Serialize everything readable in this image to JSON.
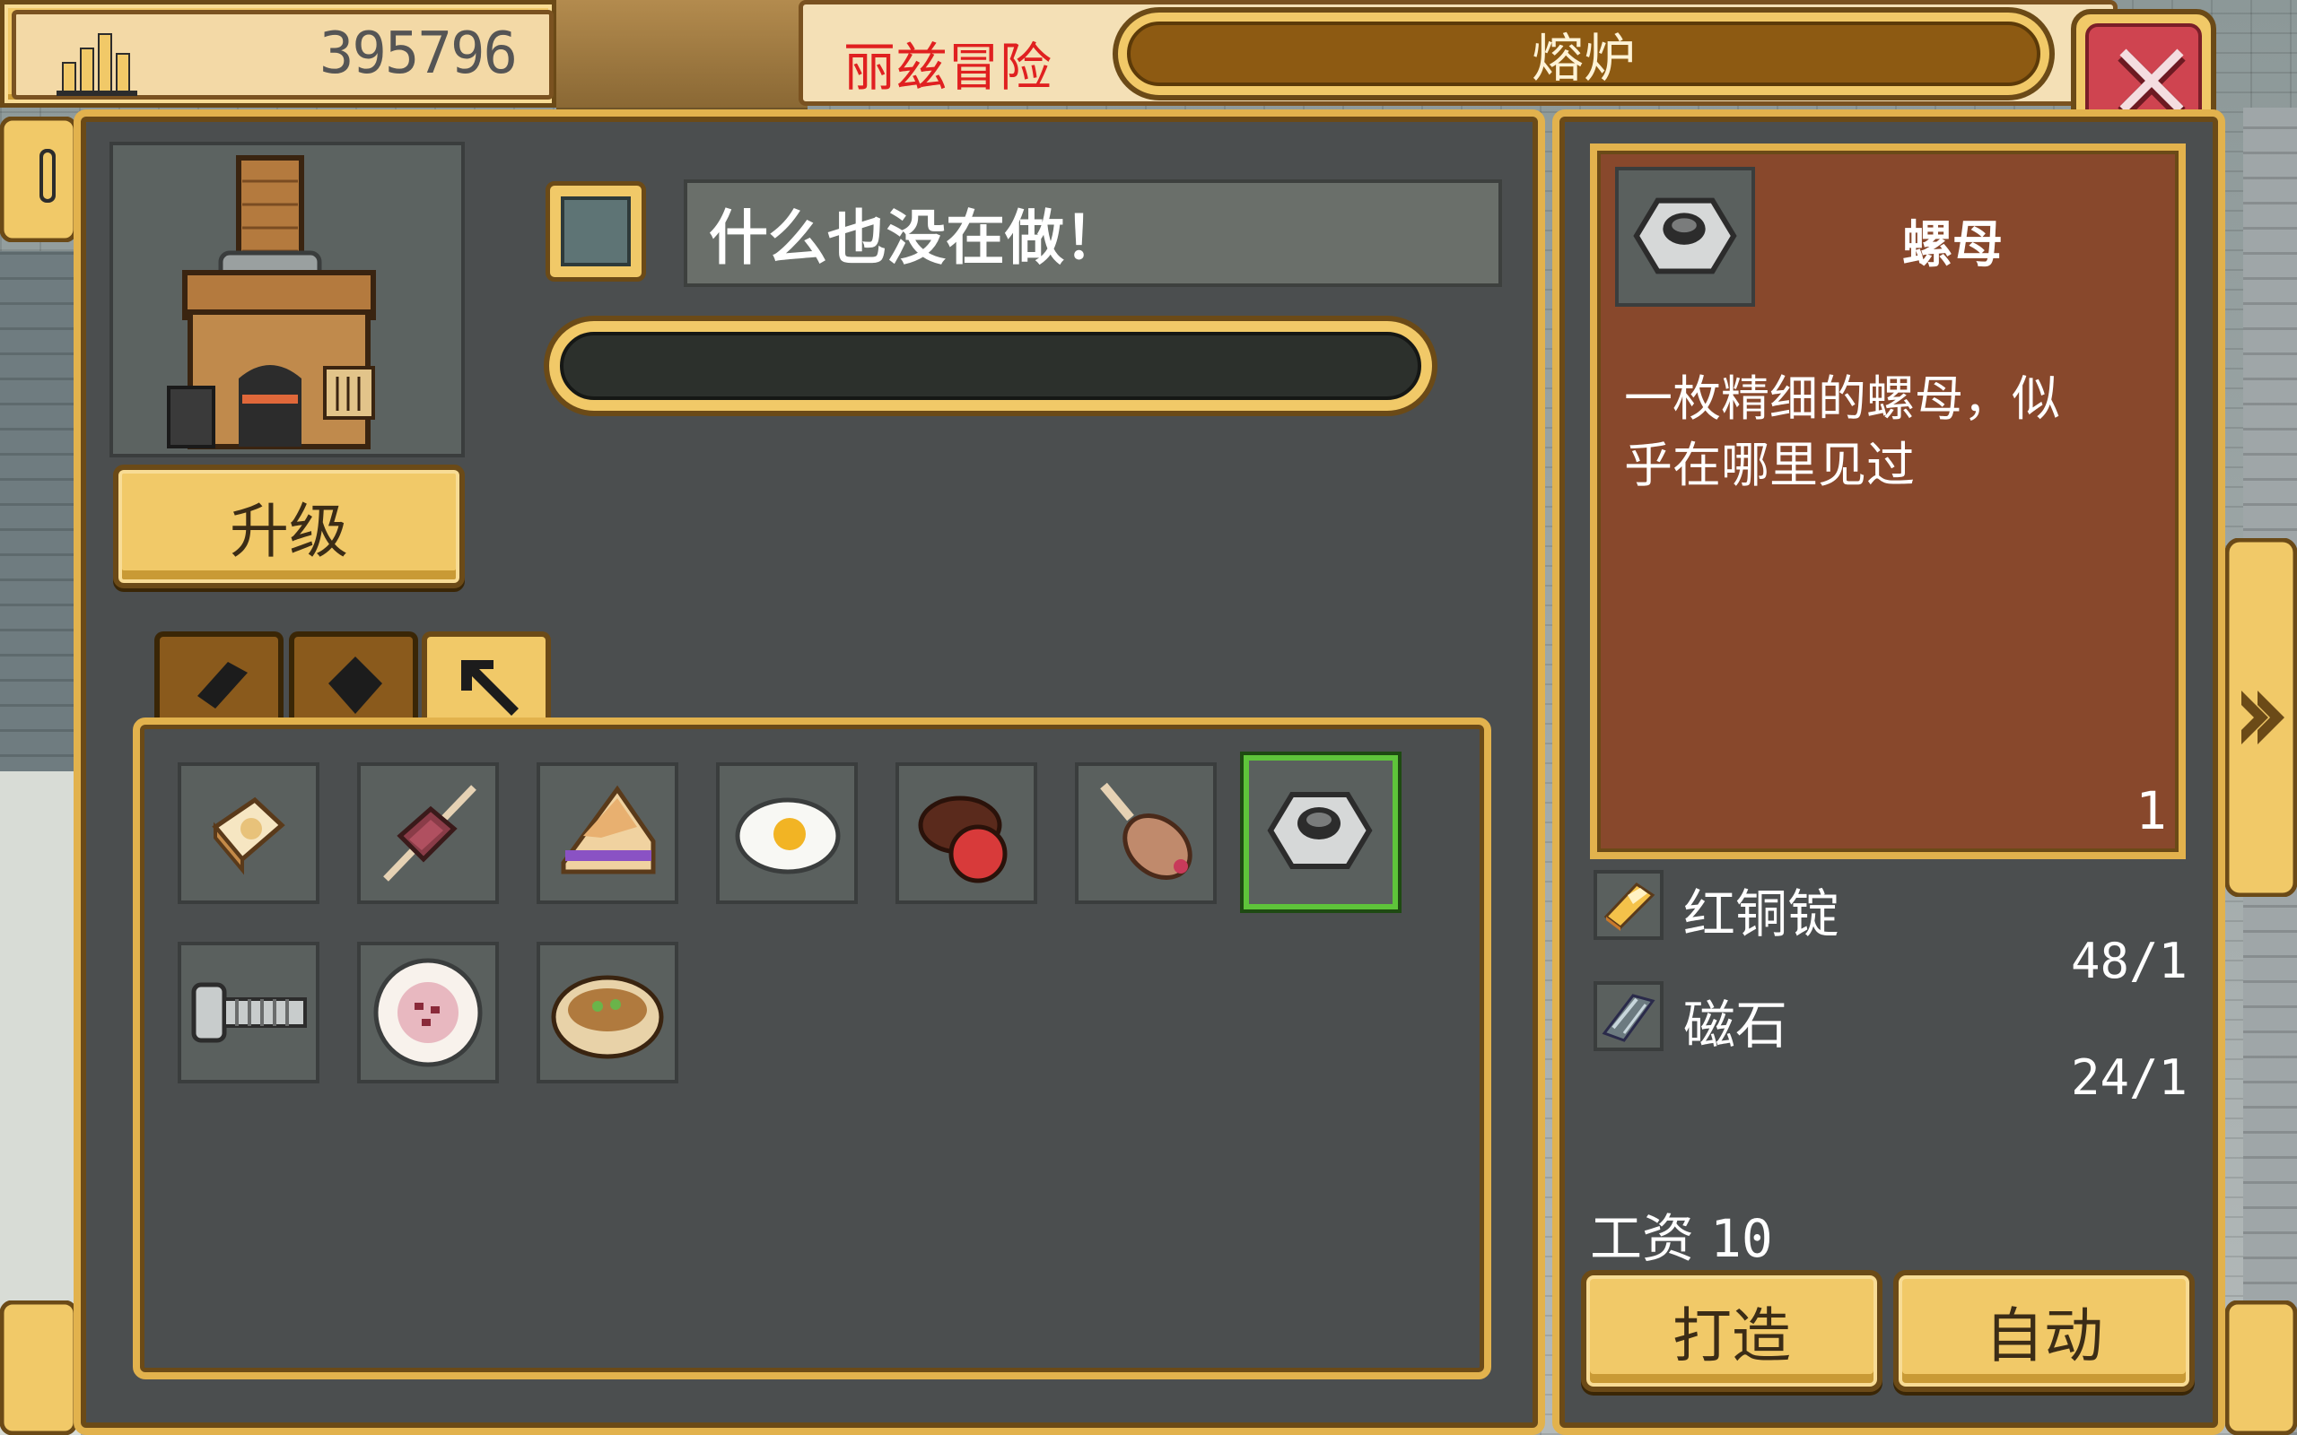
{
  "hud": {
    "coins": "395796",
    "adventure_title": "丽兹冒险"
  },
  "window": {
    "title": "熔炉"
  },
  "furnace": {
    "upgrade_label": "升级",
    "status_text": "什么也没在做！",
    "progress": 0
  },
  "tabs": [
    {
      "icon": "ingot-icon",
      "active": false
    },
    {
      "icon": "gem-icon",
      "active": false
    },
    {
      "icon": "pickaxe-icon",
      "active": true
    }
  ],
  "recipes": [
    {
      "icon": "toast-icon",
      "selected": false
    },
    {
      "icon": "meat-skewer-icon",
      "selected": false
    },
    {
      "icon": "cake-slice-icon",
      "selected": false
    },
    {
      "icon": "fried-egg-icon",
      "selected": false
    },
    {
      "icon": "roasted-acorn-icon",
      "selected": false
    },
    {
      "icon": "roasted-drumstick-icon",
      "selected": false
    },
    {
      "icon": "nut-icon",
      "selected": true
    },
    {
      "icon": "bolt-icon",
      "selected": false
    },
    {
      "icon": "meat-plate-icon",
      "selected": false
    },
    {
      "icon": "soup-bowl-icon",
      "selected": false
    }
  ],
  "detail": {
    "name": "螺母",
    "description_line1": "一枚精细的螺母，似",
    "description_line2": "乎在哪里见过",
    "count": "1",
    "materials": [
      {
        "name": "红铜锭",
        "qty": "48/1",
        "icon": "copper-ingot-icon"
      },
      {
        "name": "磁石",
        "qty": "24/1",
        "icon": "magnetite-icon"
      }
    ],
    "wage_label": "工资",
    "wage_value": "10",
    "craft_label": "打造",
    "auto_label": "自动"
  },
  "colors": {
    "gold": "#f1c968",
    "panel": "#4b4e4f",
    "card": "#88482c",
    "close_red": "#cf4450",
    "selected_green": "#5ec43a"
  }
}
